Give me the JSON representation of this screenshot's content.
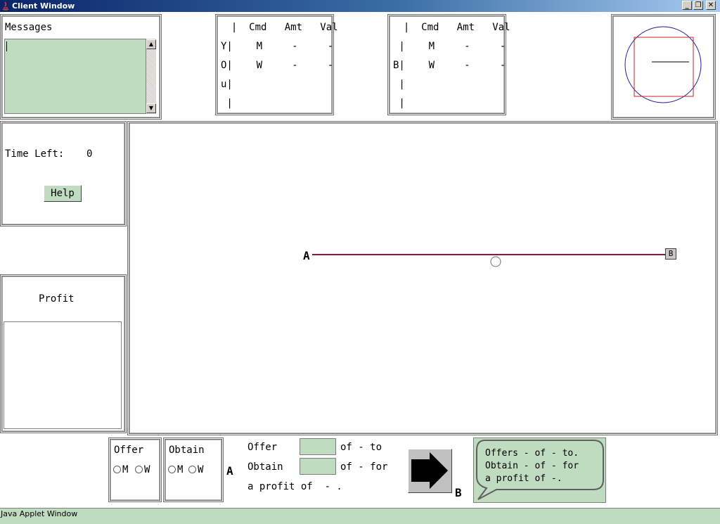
{
  "window": {
    "title": "Client Window"
  },
  "window_buttons": {
    "minimize": "_",
    "restore": "❐",
    "close": "✕"
  },
  "messages": {
    "title": "Messages",
    "text": ""
  },
  "your_table": {
    "header": "  |  Cmd   Amt   Val",
    "rows": [
      "Y|    M     -     -",
      "O|    W     -     -",
      "u|",
      " |"
    ]
  },
  "b_table": {
    "header": "  |  Cmd   Amt   Val",
    "rows": [
      " |    M     -     -",
      "B|    W     -     -",
      " |",
      " |"
    ]
  },
  "time": {
    "label": "Time Left:",
    "value": "0"
  },
  "help_button": "Help",
  "profit": {
    "title": "Profit",
    "text": ""
  },
  "field": {
    "point_a": "A",
    "point_b": "B"
  },
  "offer_box": {
    "title": "Offer",
    "opt1": "M",
    "opt2": "W"
  },
  "obtain_box": {
    "title": "Obtain",
    "opt1": "M",
    "opt2": "W"
  },
  "trade": {
    "label_a": "A",
    "offer_label": "Offer",
    "offer_suffix": "of - to",
    "obtain_label": "Obtain",
    "obtain_suffix": "of - for",
    "profit_line": "a profit of  - .",
    "offer_value": "",
    "obtain_value": "",
    "label_b": "B"
  },
  "bubble": {
    "lines": [
      "Offers - of - to.",
      "Obtain - of - for",
      "a profit of -."
    ]
  },
  "status": {
    "text": "Java Applet Window"
  },
  "colors": {
    "green": "#c0dcc0",
    "line": "#8b1a3a",
    "circle": "#1a1aa0",
    "square": "#cc2020"
  }
}
